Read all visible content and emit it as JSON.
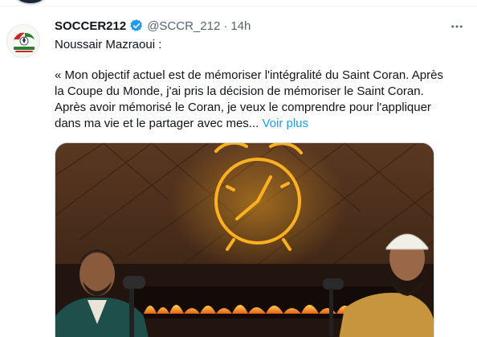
{
  "tweet": {
    "display_name": "SOCCER212",
    "handle": "@SCCR_212",
    "separator": "·",
    "time": "14h",
    "author_line": "Noussair Mazraoui :",
    "quote_lines": [
      "« Mon objectif actuel est de mémoriser l'intégralité du Saint Coran. Après",
      "la Coupe du Monde, j'ai pris la décision de mémoriser le Saint Coran.",
      "Après avoir mémorisé le Coran, je veux le comprendre pour l'appliquer",
      "dans ma vie et le partager avec mes... "
    ],
    "show_more": "Voir plus",
    "icons": {
      "verified": "verified-badge-icon",
      "more": "more-horizontal-icon",
      "logo": "soccer212-logo-icon"
    }
  },
  "colors": {
    "link": "#1d9bf0",
    "secondary_text": "#536471",
    "primary_text": "#0f1419",
    "verified_blue": "#1d9bf0",
    "neon": "#ffb020",
    "wall": "#4a2d1b"
  }
}
